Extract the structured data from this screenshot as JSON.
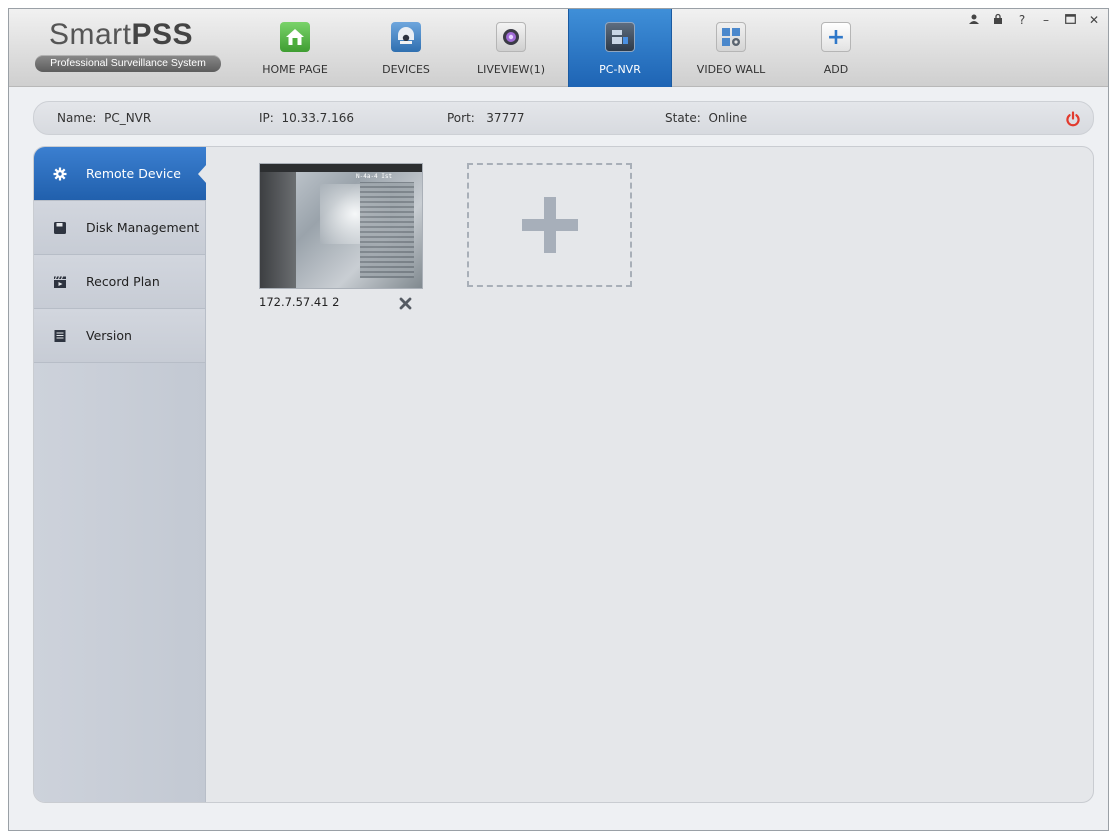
{
  "app": {
    "title_light": "Smart",
    "title_bold": "PSS",
    "subtitle": "Professional Surveillance System"
  },
  "nav": {
    "tabs": [
      {
        "label": "HOME PAGE",
        "icon": "home-icon",
        "active": false
      },
      {
        "label": "DEVICES",
        "icon": "devices-icon",
        "active": false
      },
      {
        "label": "LIVEVIEW(1)",
        "icon": "liveview-icon",
        "active": false
      },
      {
        "label": "PC-NVR",
        "icon": "pc-nvr-icon",
        "active": true
      },
      {
        "label": "VIDEO WALL",
        "icon": "video-wall-icon",
        "active": false
      },
      {
        "label": "ADD",
        "icon": "add-icon",
        "active": false
      }
    ]
  },
  "window_controls": [
    "user-icon",
    "lock-icon",
    "help-icon",
    "minimize-icon",
    "maximize-icon",
    "close-icon"
  ],
  "info": {
    "name_label": "Name:",
    "name_value": "PC_NVR",
    "ip_label": "IP:",
    "ip_value": "10.33.7.166",
    "port_label": "Port:",
    "port_value": "37777",
    "state_label": "State:",
    "state_value": "Online"
  },
  "sidebar": {
    "items": [
      {
        "label": "Remote Device",
        "icon": "gear-icon",
        "active": true
      },
      {
        "label": "Disk Management",
        "icon": "disk-icon",
        "active": false
      },
      {
        "label": "Record Plan",
        "icon": "clapperboard-icon",
        "active": false
      },
      {
        "label": "Version",
        "icon": "document-icon",
        "active": false
      }
    ]
  },
  "devices": [
    {
      "ip": "172.7.57.41 2",
      "osd": "N-4a-4 Ist"
    }
  ],
  "colors": {
    "accent_blue": "#2f74c4",
    "power_red": "#e23b2e",
    "home_green": "#4caf3c"
  }
}
